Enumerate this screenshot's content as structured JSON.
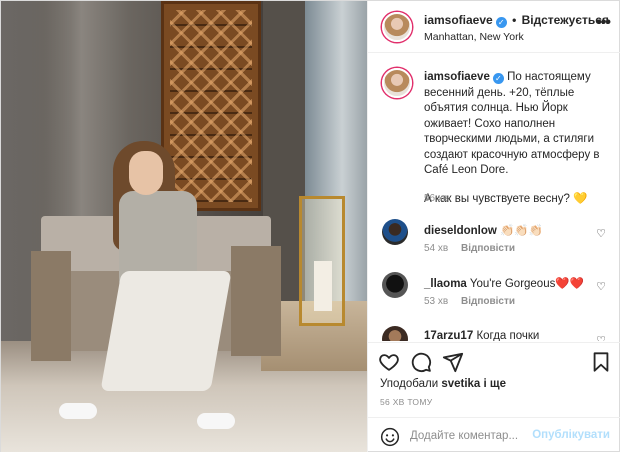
{
  "header": {
    "username": "iamsofiaeve",
    "separator": "•",
    "follow_label": "Відстежується",
    "location": "Manhattan, New York",
    "more_glyph": "•••"
  },
  "caption": {
    "username": "iamsofiaeve",
    "text": "По настоящему весенний день. +20, тёплые объятия солнца. Нью Йорк оживает! Сохо наполнен творческими людьми, а стиляги создают красочную атмосферу в Café Leon Dore.",
    "text2": "А как вы чувствуете весну?",
    "emoji": "💛",
    "time": "56 хв"
  },
  "comments": [
    {
      "username": "dieseldonlow",
      "text": "👏🏻👏🏻👏🏻",
      "time": "54 хв",
      "reply": "Відповісти"
    },
    {
      "username": "_llaoma",
      "text": "You're Gorgeous❤️❤️",
      "time": "53 хв",
      "reply": "Відповісти"
    },
    {
      "username": "17arzu17",
      "text": "Когда почки",
      "time": "",
      "reply": ""
    }
  ],
  "icons": {
    "like": "heart-icon",
    "comment": "comment-icon",
    "share": "share-icon",
    "save": "bookmark-icon",
    "emoji": "smiley-icon",
    "comment_like": "heart-icon"
  },
  "likes": {
    "prefix": "Уподобали",
    "user": "svetika",
    "suffix": "і ще"
  },
  "timestamp": "56 ХВ ТОМУ",
  "add_comment": {
    "placeholder": "Додайте коментар...",
    "post_label": "Опублікувати"
  },
  "colors": {
    "verified": "#3897f0",
    "post_button_disabled": "#b2dffc",
    "muted_text": "#8e8e8e",
    "story_ring": "#e1306c"
  }
}
